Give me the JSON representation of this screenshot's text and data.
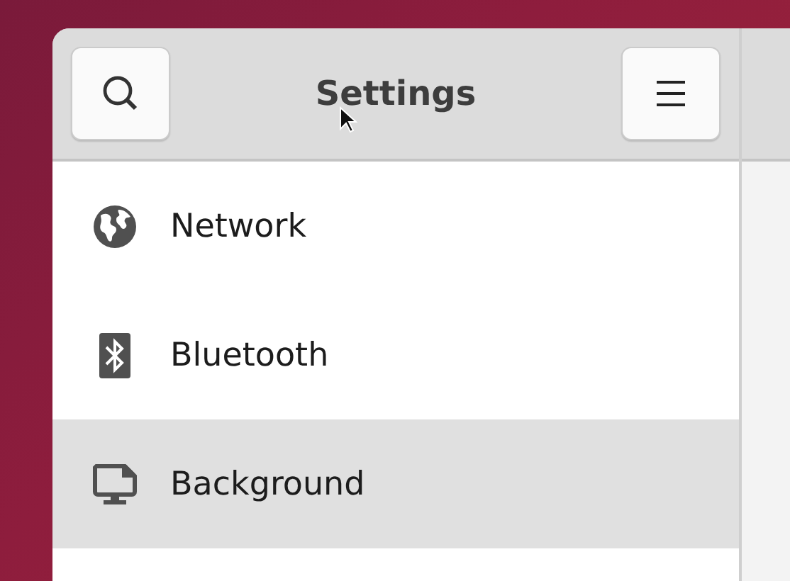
{
  "window": {
    "title": "Settings"
  },
  "sidebar": {
    "items": [
      {
        "label": "Network",
        "selected": false
      },
      {
        "label": "Bluetooth",
        "selected": false
      },
      {
        "label": "Background",
        "selected": true
      }
    ]
  }
}
